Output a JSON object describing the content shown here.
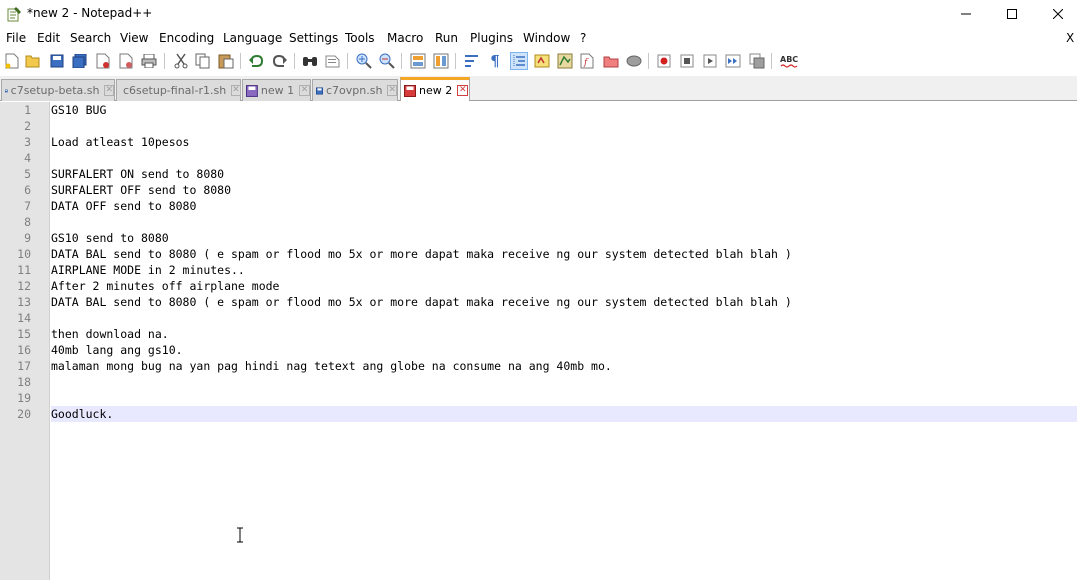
{
  "window": {
    "title": "*new 2 - Notepad++"
  },
  "menu": {
    "items": [
      "File",
      "Edit",
      "Search",
      "View",
      "Encoding",
      "Language",
      "Settings",
      "Tools",
      "Macro",
      "Run",
      "Plugins",
      "Window",
      "?"
    ],
    "close_label": "X"
  },
  "toolbar": {
    "icons": [
      "new-file-icon",
      "open-file-icon",
      "save-icon",
      "save-all-icon",
      "close-icon",
      "close-all-icon",
      "print-icon",
      "cut-icon",
      "copy-icon",
      "paste-icon",
      "undo-icon",
      "redo-icon",
      "find-icon",
      "replace-icon",
      "zoom-in-icon",
      "zoom-out-icon",
      "sync-vertical-icon",
      "sync-horizontal-icon",
      "word-wrap-icon",
      "show-all-chars-icon",
      "indent-guide-icon",
      "udl-icon",
      "doc-map-icon",
      "function-list-icon",
      "folder-workspace-icon",
      "monitor-icon",
      "record-macro-icon",
      "stop-macro-icon",
      "play-macro-icon",
      "run-macro-multiple-icon",
      "save-macro-icon",
      "spell-check-icon"
    ]
  },
  "tabs": [
    {
      "label": "c7setup-beta.sh",
      "active": false
    },
    {
      "label": "c6setup-final-r1.sh",
      "active": false
    },
    {
      "label": "new 1",
      "active": false
    },
    {
      "label": "c7ovpn.sh",
      "active": false
    },
    {
      "label": "new 2",
      "active": true
    }
  ],
  "editor": {
    "current_line": 20,
    "lines": [
      {
        "n": "1",
        "text": "GS10 BUG"
      },
      {
        "n": "2",
        "text": ""
      },
      {
        "n": "3",
        "text": "Load atleast 10pesos"
      },
      {
        "n": "4",
        "text": ""
      },
      {
        "n": "5",
        "text": "SURFALERT ON send to 8080"
      },
      {
        "n": "6",
        "text": "SURFALERT OFF send to 8080"
      },
      {
        "n": "7",
        "text": "DATA OFF send to 8080"
      },
      {
        "n": "8",
        "text": ""
      },
      {
        "n": "9",
        "text": "GS10 send to 8080"
      },
      {
        "n": "10",
        "text": "DATA BAL send to 8080 ( e spam or flood mo 5x or more dapat maka receive ng our system detected blah blah )"
      },
      {
        "n": "11",
        "text": "AIRPLANE MODE in 2 minutes.."
      },
      {
        "n": "12",
        "text": "After 2 minutes off airplane mode"
      },
      {
        "n": "13",
        "text": "DATA BAL send to 8080 ( e spam or flood mo 5x or more dapat maka receive ng our system detected blah blah )"
      },
      {
        "n": "14",
        "text": ""
      },
      {
        "n": "15",
        "text": "then download na."
      },
      {
        "n": "16",
        "text": "40mb lang ang gs10."
      },
      {
        "n": "17",
        "text": "malaman mong bug na yan pag hindi nag tetext ang globe na consume na ang 40mb mo."
      },
      {
        "n": "18",
        "text": ""
      },
      {
        "n": "19",
        "text": ""
      },
      {
        "n": "20",
        "text": "Goodluck."
      }
    ]
  },
  "colors": {
    "active_tab_accent": "#f5a623",
    "gutter_bg": "#e4e4e4",
    "current_line_bg": "#e8e8ff"
  }
}
